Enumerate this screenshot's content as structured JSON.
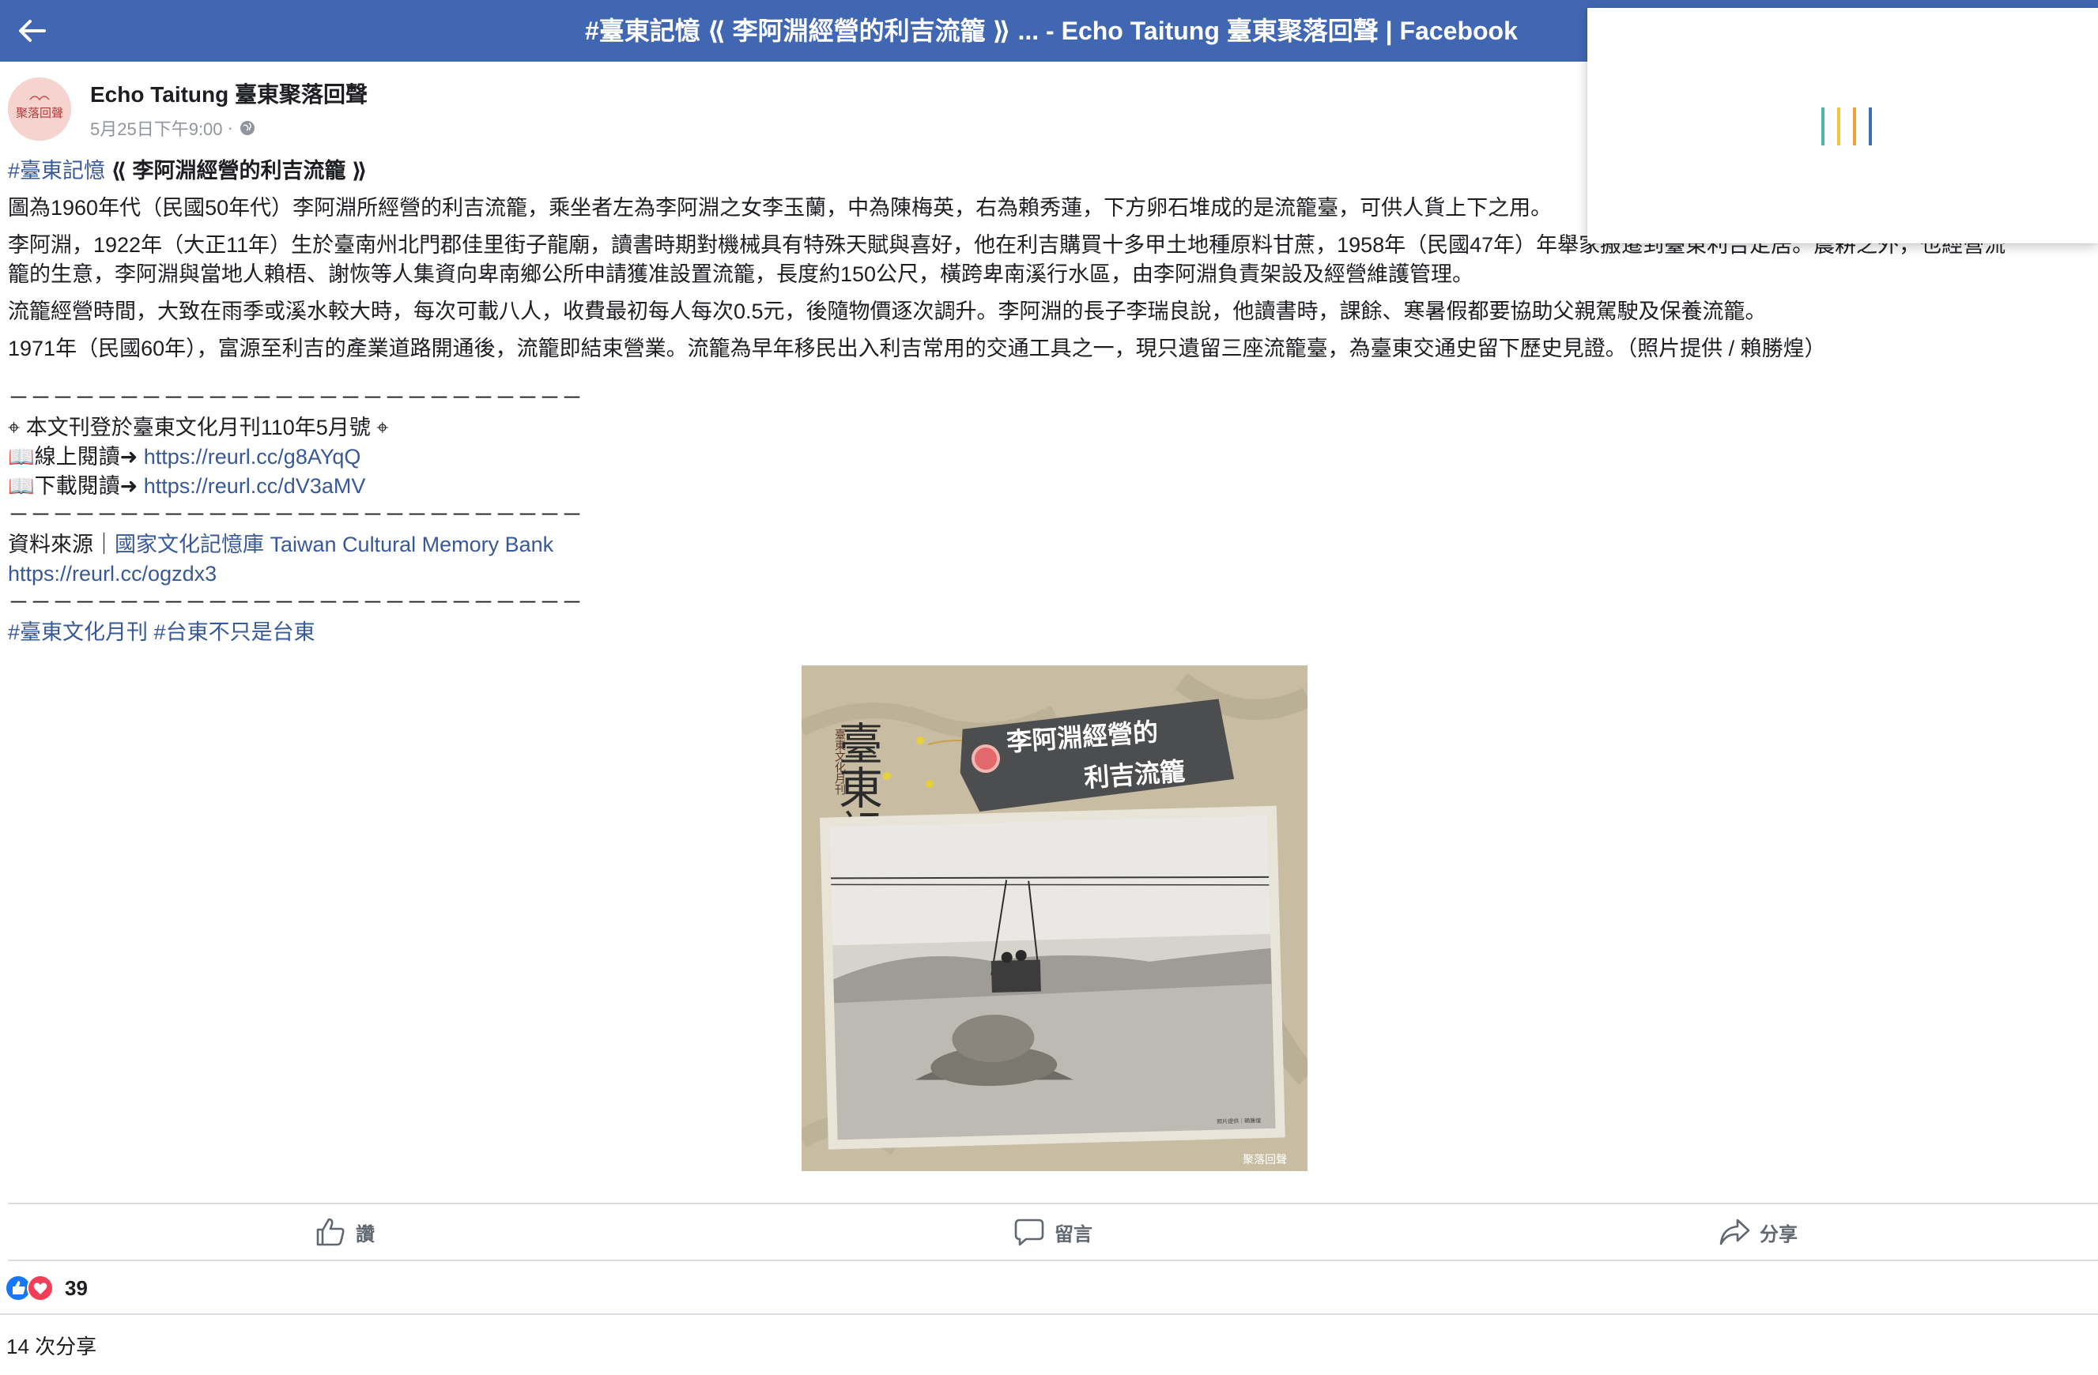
{
  "window": {
    "title": "#臺東記憶 ⟪ 李阿淵經營的利吉流籠 ⟫ ... - Echo Taitung 臺東聚落回聲 | Facebook"
  },
  "post": {
    "page_name": "Echo Taitung 臺東聚落回聲",
    "timestamp": "5月25日下午9:00",
    "avatar_text": "聚落回聲",
    "title_hashtag": "#臺東記憶",
    "title_text": " ⟪ 李阿淵經營的利吉流籠 ⟫",
    "para1": "圖為1960年代（民國50年代）李阿淵所經營的利吉流籠，乘坐者左為李阿淵之女李玉蘭，中為陳梅英，右為賴秀蓮，下方卵石堆成的是流籠臺，可供人貨上下之用。",
    "para2a": "李阿淵，1922年（大正11年）生於臺南州北門郡佳里街子龍廟，讀書時期對機械具有特殊天賦與喜好，他在利吉購買十多甲土地種原料甘蔗，1958年（民國47年）年舉家搬遷到臺東利吉定居。農耕之外，也經營流",
    "para2b": "籠的生意，李阿淵與當地人賴梧、謝恢等人集資向卑南鄉公所申請獲准設置流籠，長度約150公尺，橫跨卑南溪行水區，由李阿淵負責架設及經營維護管理。",
    "para3": "流籠經營時間，大致在雨季或溪水較大時，每次可載八人，收費最初每人每次0.5元，後隨物價逐次調升。李阿淵的長子李瑞良說，他讀書時，課餘、寒暑假都要協助父親駕駛及保養流籠。",
    "para4": "1971年（民國60年），富源至利吉的產業道路開通後，流籠即結束營業。流籠為早年移民出入利吉常用的交通工具之一，現只遺留三座流籠臺，為臺東交通史留下歷史見證。（照片提供 / 賴勝煌）",
    "rule": "－－－－－－－－－－－－－－－－－－－－－－－－－－",
    "pub_line": "⌖ 本文刊登於臺東文化月刊110年5月號 ⌖",
    "read_label": "📖線上閱讀➜ ",
    "read_link": "https://reurl.cc/g8AYqQ",
    "download_label": "📖下載閱讀➜ ",
    "download_link": "https://reurl.cc/dV3aMV",
    "source_label": "資料來源｜",
    "source_link": "國家文化記憶庫 Taiwan Cultural Memory Bank",
    "source_url": "https://reurl.cc/ogzdx3",
    "hashtag1": "#臺東文化月刊",
    "hashtag2": "#台東不只是台東"
  },
  "figure": {
    "vertical_title": "臺東記憶",
    "side_caption": "臺東文化月刊",
    "tag_line1": "李阿淵經營的",
    "tag_line2": "利吉流籠",
    "logo_text": "聚落回聲",
    "photo_credit": "照片提供｜賴勝煌"
  },
  "actions": {
    "like_label": "讚",
    "comment_label": "留言",
    "share_label": "分享"
  },
  "stats": {
    "reaction_count": "39",
    "share_count_text": "14 次分享"
  },
  "colors": {
    "facebook_blue": "#4267b2",
    "link_blue": "#385898",
    "like_blue": "#1877f2",
    "love_red": "#f33e58"
  }
}
